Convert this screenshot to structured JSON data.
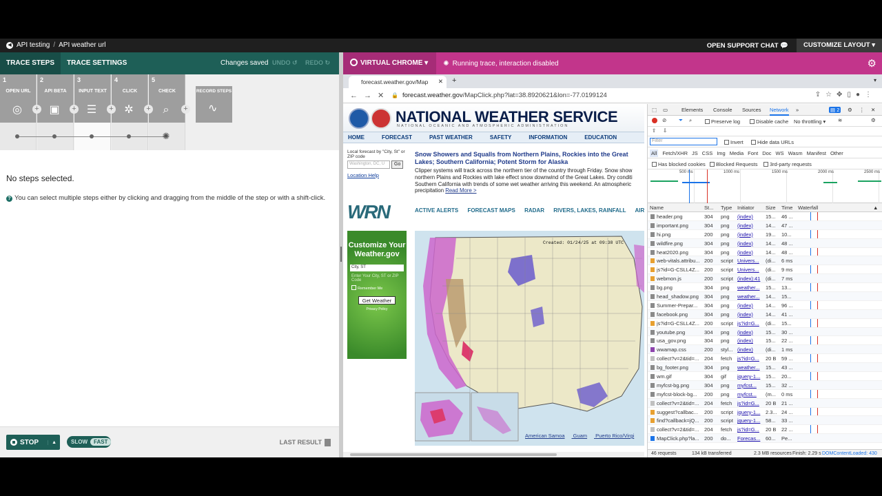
{
  "topbar": {
    "crumb_root": "API testing",
    "crumb_sep": "/",
    "crumb_current": "API weather url",
    "support": "OPEN SUPPORT CHAT",
    "layout": "CUSTOMIZE LAYOUT"
  },
  "left": {
    "tab_steps": "TRACE STEPS",
    "tab_settings": "TRACE SETTINGS",
    "saved": "Changes saved",
    "undo": "UNDO",
    "redo": "REDO",
    "steps": [
      {
        "num": "1",
        "label": "OPEN URL",
        "icon": "globe-icon"
      },
      {
        "num": "2",
        "label": "API BETA",
        "icon": "api-icon"
      },
      {
        "num": "3",
        "label": "INPUT TEXT",
        "icon": "text-input-icon"
      },
      {
        "num": "4",
        "label": "CLICK",
        "icon": "click-icon"
      },
      {
        "num": "5",
        "label": "CHECK",
        "icon": "check-icon"
      }
    ],
    "record": "RECORD STEPS",
    "no_steps": "No steps selected.",
    "hint": "You can select multiple steps either by clicking and dragging from the middle of the step or with a shift-click.",
    "stop": "STOP",
    "slow": "SLOW",
    "fast": "FAST",
    "last_result": "LAST RESULT"
  },
  "right": {
    "virtual_chrome": "VIRTUAL CHROME",
    "running": "Running trace, interaction disabled",
    "tab_title": "forecast.weather.gov/Map",
    "url_domain": "forecast.weather.gov",
    "url_path": "/MapClick.php?lat=38.8920621&lon=-77.0199124"
  },
  "nws": {
    "title": "NATIONAL WEATHER SERVICE",
    "subtitle": "NATIONAL OCEANIC AND ATMOSPHERIC ADMINISTRATION",
    "nav": [
      "HOME",
      "FORECAST",
      "PAST WEATHER",
      "SAFETY",
      "INFORMATION",
      "EDUCATION"
    ],
    "local_label": "Local forecast by \"City, St\" or ZIP code",
    "local_placeholder": "Washington, DC, U",
    "go": "Go",
    "location_help": "Location Help",
    "headline": "Snow Showers and Squalls from Northern Plains, Rockies into the Great Lakes; Southern California; Potent Storm for Alaska",
    "para_lines": [
      "Clipper systems will track across the northern tier of the country through Friday. Snow show",
      "northern Plains and Rockies with lake effect snow downwind of the Great Lakes. Dry conditi",
      "Southern California with trends of some wet weather arriving this weekend. An atmospheric",
      "precipitation"
    ],
    "read_more": "Read More >",
    "wrn": "WRN",
    "wrn_nav": [
      "ACTIVE ALERTS",
      "FORECAST MAPS",
      "RADAR",
      "RIVERS, LAKES, RAINFALL",
      "AIR QUALIT"
    ],
    "customize": "Customize Your Weather.gov",
    "city_field": "City, ST",
    "enter_hint": "Enter Your City, ST or ZIP Code",
    "remember": "Remember Me",
    "get_weather": "Get Weather",
    "privacy": "Privacy Policy",
    "created": "Created: 01/24/25 at 09:38 UTC",
    "map_links": [
      "American Samoa",
      "Guam",
      "Puerto Rico/Virgi"
    ]
  },
  "devtools": {
    "tabs": [
      "Elements",
      "Console",
      "Sources",
      "Network"
    ],
    "active_tab": "Network",
    "badge": "2",
    "preserve_log": "Preserve log",
    "disable_cache": "Disable cache",
    "throttling": "No throttling",
    "filter_placeholder": "Filter",
    "invert": "Invert",
    "hide_data": "Hide data URLs",
    "types": [
      "All",
      "Fetch/XHR",
      "JS",
      "CSS",
      "Img",
      "Media",
      "Font",
      "Doc",
      "WS",
      "Wasm",
      "Manifest",
      "Other"
    ],
    "blocked_cookies": "Has blocked cookies",
    "blocked_requests": "Blocked Requests",
    "third_party": "3rd-party requests",
    "overview_labels": [
      "500 ms",
      "1000 ms",
      "1500 ms",
      "2000 ms",
      "2500 ms"
    ],
    "columns": [
      "Name",
      "St...",
      "Type",
      "Initiator",
      "Size",
      "Time",
      "Waterfall"
    ],
    "rows": [
      [
        "header.png",
        "304",
        "png",
        "(index)",
        "15...",
        "46 ..."
      ],
      [
        "important.png",
        "304",
        "png",
        "(index)",
        "14...",
        "47 ..."
      ],
      [
        "hi.png",
        "200",
        "png",
        "(index)",
        "19...",
        "10..."
      ],
      [
        "wildfire.png",
        "304",
        "png",
        "(index)",
        "14...",
        "48 ..."
      ],
      [
        "heat2020.png",
        "304",
        "png",
        "(index)",
        "14...",
        "48 ..."
      ],
      [
        "web-vitals.attribu...",
        "200",
        "script",
        "Univers...",
        "(di...",
        "6 ms"
      ],
      [
        "js?id=G-CSLL4Z...",
        "200",
        "script",
        "Univers...",
        "(di...",
        "9 ms"
      ],
      [
        "webmon.js",
        "200",
        "script",
        "(index):41",
        "(di...",
        "7 ms"
      ],
      [
        "bg.png",
        "304",
        "png",
        "weather...",
        "15...",
        "13..."
      ],
      [
        "head_shadow.png",
        "304",
        "png",
        "weather...",
        "14...",
        "15..."
      ],
      [
        "Summer-Prepar...",
        "304",
        "png",
        "(index)",
        "14...",
        "96 ..."
      ],
      [
        "facebook.png",
        "304",
        "png",
        "(index)",
        "14...",
        "41 ..."
      ],
      [
        "js?id=G-CSLL4Z...",
        "200",
        "script",
        "js?id=G...",
        "(di...",
        "15..."
      ],
      [
        "youtube.png",
        "304",
        "png",
        "(index)",
        "15...",
        "30 ..."
      ],
      [
        "usa_gov.png",
        "304",
        "png",
        "(index)",
        "15...",
        "22 ..."
      ],
      [
        "wwamap.css",
        "200",
        "styl...",
        "(index)",
        "(di...",
        "1 ms"
      ],
      [
        "collect?v=2&tid=...",
        "204",
        "fetch",
        "js?id=G...",
        "20 B",
        "59 ..."
      ],
      [
        "bg_footer.png",
        "304",
        "png",
        "weather...",
        "15...",
        "43 ..."
      ],
      [
        "wm.gif",
        "304",
        "gif",
        "jquery-1...",
        "15...",
        "20..."
      ],
      [
        "myfcst-bg.png",
        "304",
        "png",
        "myfcst...",
        "15...",
        "32 ..."
      ],
      [
        "myfcst-block-bg...",
        "200",
        "png",
        "myfcst...",
        "(m...",
        "0 ms"
      ],
      [
        "collect?v=2&tid=...",
        "204",
        "fetch",
        "js?id=G...",
        "20 B",
        "21 ..."
      ],
      [
        "suggest?callbac...",
        "200",
        "script",
        "jquery-1...",
        "2.3...",
        "24 ..."
      ],
      [
        "find?callback=jQ...",
        "200",
        "script",
        "jquery-1...",
        "58...",
        "33 ..."
      ],
      [
        "collect?v=2&tid=...",
        "204",
        "fetch",
        "js?id=G...",
        "20 B",
        "22 ..."
      ],
      [
        "MapClick.php?la...",
        "200",
        "do...",
        "Forecas...",
        "60...",
        "Pe..."
      ]
    ],
    "footer_requests": "46 requests",
    "footer_transferred": "134 kB transferred",
    "footer_resources": "2.3 MB resources",
    "footer_finish": "Finish: 2.29 s",
    "footer_dom": "DOMContentLoaded: 430"
  },
  "colors": {
    "teal": "#1e5f57",
    "magenta": "#c2358b",
    "nws_navy": "#0a1e49"
  }
}
